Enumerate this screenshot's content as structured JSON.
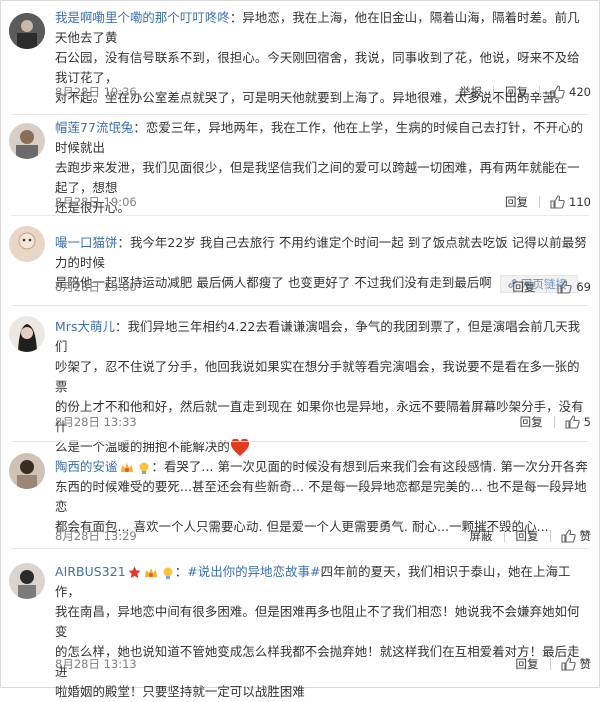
{
  "comments": [
    {
      "user": "我是啊嘞里个嘞的那个叮叮咚咚",
      "text_lines": [
        "：异地恋，我在上海，他在旧金山，隔着山海，隔着时差。前几天他去了黄",
        "石公园，没有信号联系不到，很担心。今天刚回宿舍，我说，同事收到了花，他说，呀来不及给我订花了，",
        "对不起。坐在办公室差点就哭了，可是明天他就要到上海了。异地很难，太多说不出的辛苦。"
      ],
      "time": "8月28日 19:36",
      "actions": [
        "举报",
        "回复"
      ],
      "likes": "420"
    },
    {
      "user": "帽莲77流氓兔",
      "text_lines": [
        "：恋爱三年，异地两年，我在工作，他在上学，生病的时候自己去打针，不开心的时候就出",
        "去跑步来发泄，我们见面很少，但是我坚信我们之间的爱可以跨越一切困难，再有两年就能在一起了，想想",
        "还是很开心。"
      ],
      "time": "8月28日 19:06",
      "actions": [
        "回复"
      ],
      "likes": "110"
    },
    {
      "user": "嘬一口猫饼",
      "text_lines": [
        "：我今年22岁 我自己去旅行 不用约谁定个时间一起 到了饭点就去吃饭 记得以前最努力的时候",
        "是陪他一起坚持运动减肥 最后俩人都瘦了 也变更好了 不过我们没有走到最后啊"
      ],
      "weblink": "网页链接",
      "time": "8月28日 19:00",
      "actions": [
        "回复"
      ],
      "likes": "69"
    },
    {
      "user": "Mrs大萌儿",
      "text_lines": [
        "：我们异地三年相约4.22去看谦谦演唱会，争气的我团到票了，但是演唱会前几天我们",
        "吵架了，忍不住说了分手，他回我说如果实在想分手就等看完演唱会，我说要不是看在多一张的票",
        "的份上才不和他和好，然后就一直走到现在 如果你也是异地，永远不要隔着屏幕吵架分手，没有什",
        "么是一个温暖的拥抱不能解决的"
      ],
      "time": "8月28日 13:33",
      "actions": [
        "回复"
      ],
      "likes": "5"
    },
    {
      "user": "陶西的安谧",
      "text_lines": [
        "：看哭了... 第一次见面的时候没有想到后来我们会有这段感情. 第一次分开各奔",
        "东西的时候难受的要死...甚至还会有些新奇... 不是每一段异地恋都是完美的... 也不是每一段异地恋",
        "都会有面包... 喜欢一个人只需要心动. 但是爱一个人更需要勇气. 耐心...一颗摧不毁的心..."
      ],
      "time": "8月28日 13:29",
      "actions": [
        "屏蔽",
        "回复"
      ],
      "likes": "赞"
    },
    {
      "user": "AIRBUS321",
      "hashtag": "#说出你的异地恋故事#",
      "text_lines": [
        "四年前的夏天，我们相识于泰山，她在上海工作，",
        "我在南昌，异地恋中间有很多困难。但是困难再多也阻止不了我们相恋！她说我不会嫌弃她如何变",
        "的怎么样，她也说知道不管她变成怎么样我都不会抛弃她！就这样我们在互相爱着对方！最后走进",
        "啦婚姻的殿堂！只要坚持就一定可以战胜困难"
      ],
      "time": "8月28日 13:13",
      "actions": [
        "回复"
      ],
      "likes": "赞"
    }
  ]
}
